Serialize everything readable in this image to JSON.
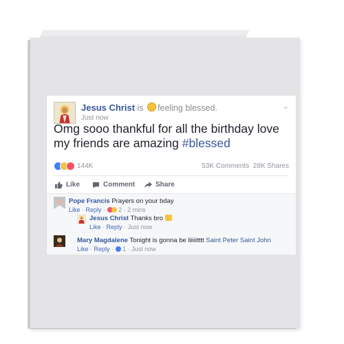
{
  "post": {
    "author": "Jesus Christ",
    "is_text": "is",
    "feeling_text": "feeling blessed.",
    "time": "Just now",
    "chevron": "⌄",
    "status_text": "Omg sooo thankful for all the birthday love my friends are amazing",
    "hashtag": "#blessed",
    "reaction_count": "144K",
    "comments_count": "53K Comments",
    "shares_count": "28K Shares",
    "actions": {
      "like": "Like",
      "comment": "Comment",
      "share": "Share"
    }
  },
  "comments": [
    {
      "author": "Pope Francis",
      "text": "Prayers on your bday",
      "meta_like": "Like",
      "meta_reply": "Reply",
      "meta_reaction_count": "2",
      "meta_time": "2 mins",
      "sep": "·"
    },
    {
      "author": "Jesus Christ",
      "text": "Thanks bro",
      "meta_like": "Like",
      "meta_reply": "Reply",
      "meta_time": "Just now",
      "sep": "·"
    },
    {
      "author": "Mary Magdalene",
      "text": "Tonight is gonna be liiiiitttt",
      "tags": "Saint Peter Saint John",
      "meta_like": "Like",
      "meta_reply": "Reply",
      "meta_reaction_count": "1",
      "meta_time": "Just now",
      "sep": "·"
    }
  ],
  "icons": {
    "feeling": "smiling-face-icon",
    "like": "thumbs-up-icon",
    "comment": "speech-bubble-icon",
    "share": "share-arrow-icon"
  },
  "colors": {
    "link_blue": "#365899",
    "like_blue": "#4080ff",
    "love_red": "#f25268",
    "haha_yellow": "#f5c33b",
    "card_gray": "#e4e4e6"
  }
}
